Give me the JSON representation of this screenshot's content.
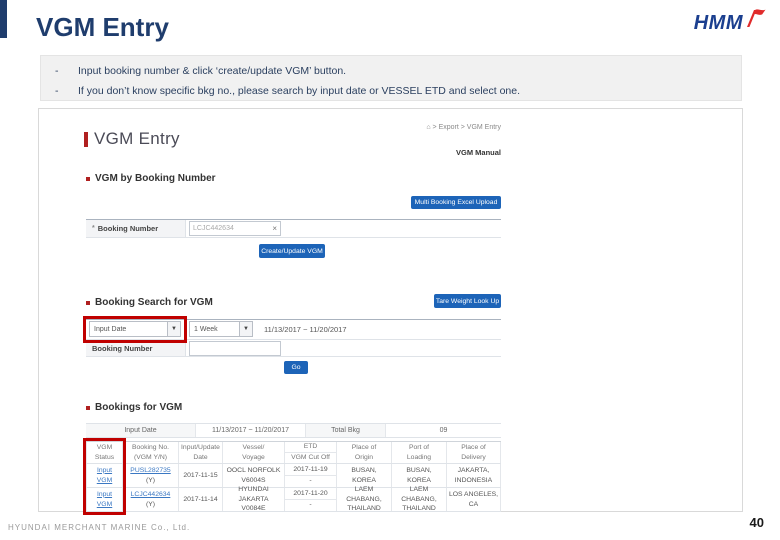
{
  "colors": {
    "brand_navy": "#1f3d6d",
    "accent_blue": "#1d64b8",
    "annotation_red": "#c00000",
    "link_blue": "#3b78c3",
    "logo_blue": "#1b3f8f",
    "logo_red": "#e02b2b"
  },
  "icons": {
    "home": "⌂",
    "chevron_down": "▼",
    "clear": "×"
  },
  "slide": {
    "title": "VGM Entry",
    "logo_text": "HMM",
    "notes": [
      {
        "dash": "-",
        "text": "Input booking number & click ‘create/update VGM’ button."
      },
      {
        "dash": "-",
        "text": "If you don’t know specific bkg no., please search by input date or VESSEL ETD and select one."
      }
    ],
    "footer": "HYUNDAI MERCHANT MARINE Co., Ltd.",
    "page_number": "40"
  },
  "shot": {
    "heading": "VGM Entry",
    "breadcrumb_path": "> Export > VGM Entry",
    "manual_link": "VGM Manual",
    "by_booking": {
      "title": "VGM by Booking Number",
      "excel_button": "Multi Booking Excel Upload",
      "required_mark": "*",
      "booking_label": "Booking Number",
      "booking_value": "LCJC442634",
      "submit_button": "Create/Update VGM"
    },
    "search": {
      "title": "Booking Search for VGM",
      "tare_button": "Tare Weight Look Up",
      "date_type_value": "Input Date",
      "period_value": "1 Week",
      "date_range": "11/13/2017 ~ 11/20/2017",
      "booking_label": "Booking Number",
      "booking_value": "",
      "go_button": "Go"
    },
    "bookings": {
      "title": "Bookings for VGM",
      "summary": {
        "input_date_label": "Input Date",
        "date_range": "11/13/2017 ~ 11/20/2017",
        "total_label": "Total Bkg",
        "total_value": "09"
      },
      "headers": [
        [
          "VGM",
          "Status"
        ],
        [
          "Booking No.",
          "(VGM Y/N)"
        ],
        [
          "Input/Update",
          "Date"
        ],
        [
          "Vessel/",
          "Voyage"
        ],
        {
          "top": "ETD",
          "bottom": "VGM Cut Off"
        },
        [
          "Place of",
          "Origin"
        ],
        [
          "Port of",
          "Loading"
        ],
        [
          "Place of",
          "Delivery"
        ]
      ],
      "rows": [
        {
          "status": [
            "Input",
            "VGM"
          ],
          "booking": [
            "PUSL282735",
            "(Y)"
          ],
          "date": [
            "2017-11-15"
          ],
          "vessel": [
            "OOCL NORFOLK",
            "V6004S"
          ],
          "etd": [
            "2017-11-19",
            "-"
          ],
          "origin": [
            "BUSAN,",
            "KOREA"
          ],
          "loading": [
            "BUSAN,",
            "KOREA"
          ],
          "delivery": [
            "JAKARTA,",
            "INDONESIA"
          ]
        },
        {
          "status": [
            "Input",
            "VGM"
          ],
          "booking": [
            "LCJC442634",
            "(Y)"
          ],
          "date": [
            "2017-11-14"
          ],
          "vessel": [
            "HYUNDAI JAKARTA",
            "V0084E"
          ],
          "etd": [
            "2017-11-20",
            "-"
          ],
          "origin": [
            "LAEM CHABANG,",
            "THAILAND"
          ],
          "loading": [
            "LAEM CHABANG,",
            "THAILAND"
          ],
          "delivery": [
            "LOS ANGELES,",
            "CA"
          ]
        }
      ]
    }
  }
}
